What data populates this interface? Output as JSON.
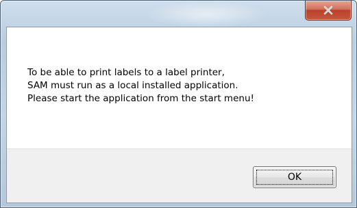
{
  "dialog": {
    "close_button": {
      "icon": "close-icon"
    },
    "message_lines": [
      "To be able to print labels to a label printer,",
      "SAM must run as a local installed application.",
      "Please start the application from the start menu!"
    ],
    "ok_label": "OK"
  },
  "colors": {
    "close_button_red": "#c7553b",
    "frame_blue": "#c3d5e6",
    "footer_gray": "#f0f0f0"
  }
}
